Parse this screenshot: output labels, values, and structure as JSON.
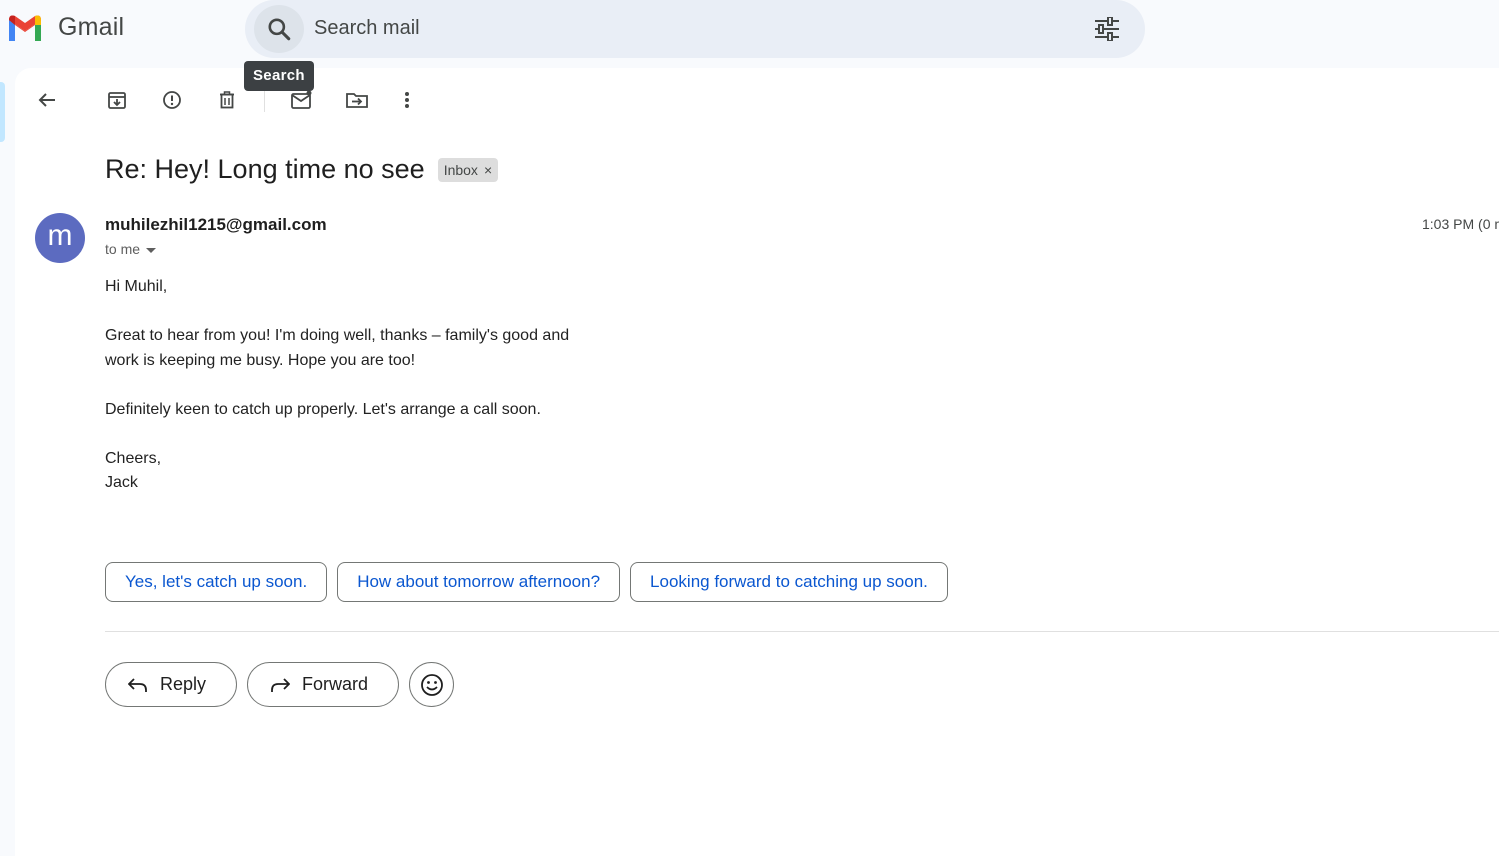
{
  "app": {
    "name": "Gmail",
    "logo_icon": "gmail-logo-icon"
  },
  "search": {
    "placeholder": "Search mail",
    "tooltip": "Search",
    "icon": "search-icon",
    "options_icon": "tune-icon"
  },
  "toolbar": {
    "icons": [
      "back-arrow-icon",
      "archive-icon",
      "report-spam-icon",
      "delete-icon",
      "mark-unread-icon",
      "move-to-icon",
      "more-vert-icon"
    ]
  },
  "message": {
    "subject": "Re: Hey! Long time no see",
    "label": "Inbox",
    "label_remove": "×",
    "sender_initial": "m",
    "sender": "muhilezhil1215@gmail.com",
    "recipient": "to me",
    "time": "1:03 PM (0 m",
    "body": {
      "greeting": "Hi Muhil,",
      "para1_line1": "Great to hear from you! I'm doing well, thanks – family's good and",
      "para1_line2": "work is keeping me busy. Hope you are too!",
      "para2": "Definitely keen to catch up properly. Let's arrange a call soon.",
      "closing": "Cheers,",
      "signature": "Jack"
    }
  },
  "smart_replies": [
    "Yes, let's catch up soon.",
    "How about tomorrow afternoon?",
    "Looking forward to catching up soon."
  ],
  "actions": {
    "reply": "Reply",
    "forward": "Forward",
    "emoji_icon": "emoji-reaction-icon"
  },
  "colors": {
    "accent_blue": "#0b57d0",
    "avatar": "#5c6bc0",
    "search_bg": "#e9eef6",
    "label_bg": "#dddddd"
  }
}
